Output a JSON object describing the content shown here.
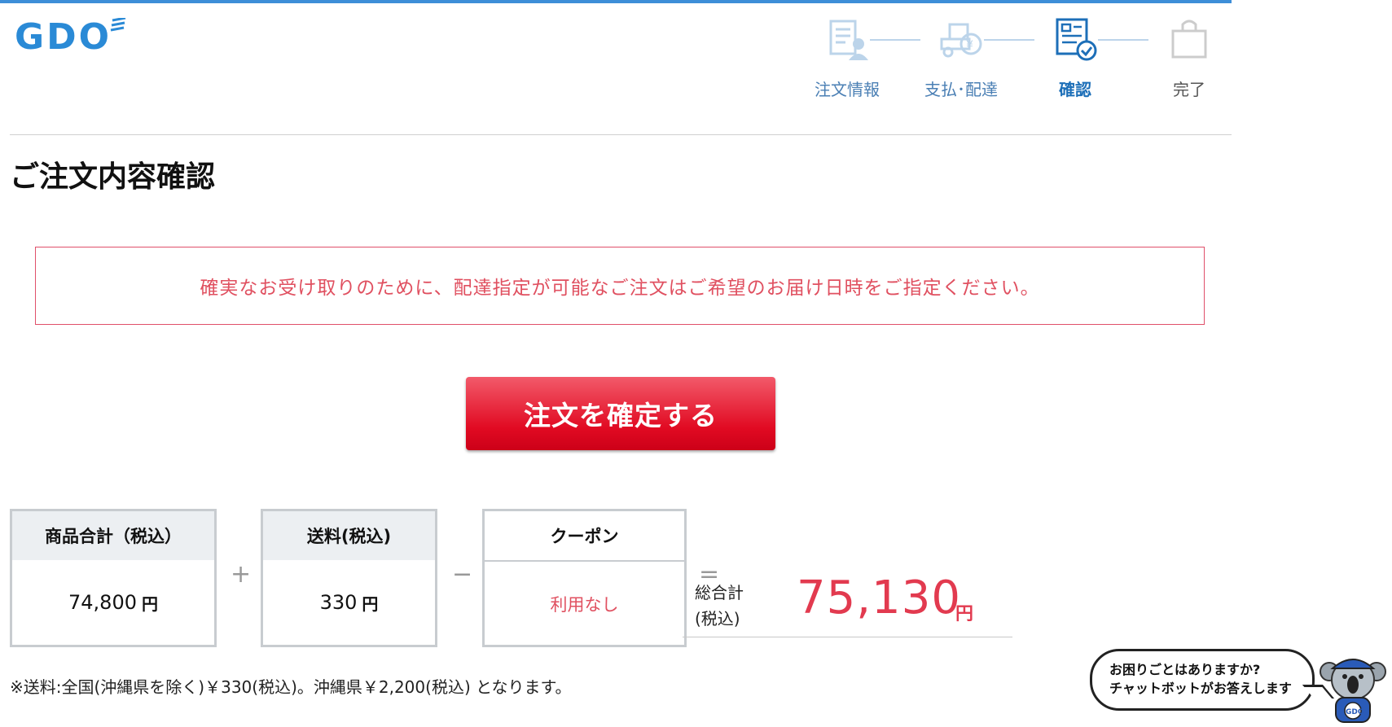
{
  "header": {
    "logo_text": "GDO"
  },
  "steps": [
    {
      "label": "注文情報",
      "icon": "order-info-icon"
    },
    {
      "label": "支払･配達",
      "icon": "truck-payment-icon"
    },
    {
      "label": "確認",
      "icon": "confirm-check-icon"
    },
    {
      "label": "完了",
      "icon": "shopping-bag-icon"
    }
  ],
  "page": {
    "title": "ご注文内容確認"
  },
  "notice": {
    "text": "確実なお受け取りのために、配達指定が可能なご注文はご希望のお届け日時をご指定ください。"
  },
  "confirm_button": {
    "label": "注文を確定する"
  },
  "summary": {
    "items": {
      "label": "商品合計（税込）",
      "value": "74,800",
      "unit": "円"
    },
    "shipping": {
      "label": "送料(税込)",
      "value": "330",
      "unit": "円"
    },
    "coupon": {
      "label": "クーポン",
      "value": "利用なし"
    },
    "plus": "+",
    "minus": "−",
    "equals": "=",
    "total": {
      "label_line1": "総合計",
      "label_line2": "(税込)",
      "value": "75,130",
      "unit": "円"
    }
  },
  "shipping_note": "※送料:全国(沖縄県を除く)￥330(税込)。沖縄県￥2,200(税込) となります。",
  "chat": {
    "line1": "お困りごとはありますか?",
    "line2": "チャットボットがお答えします",
    "badge": "GDO"
  },
  "colors": {
    "brand_blue": "#2a8ad6",
    "accent_red": "#e10a22",
    "notice_red": "#e05060",
    "total_red": "#e23a4f"
  }
}
